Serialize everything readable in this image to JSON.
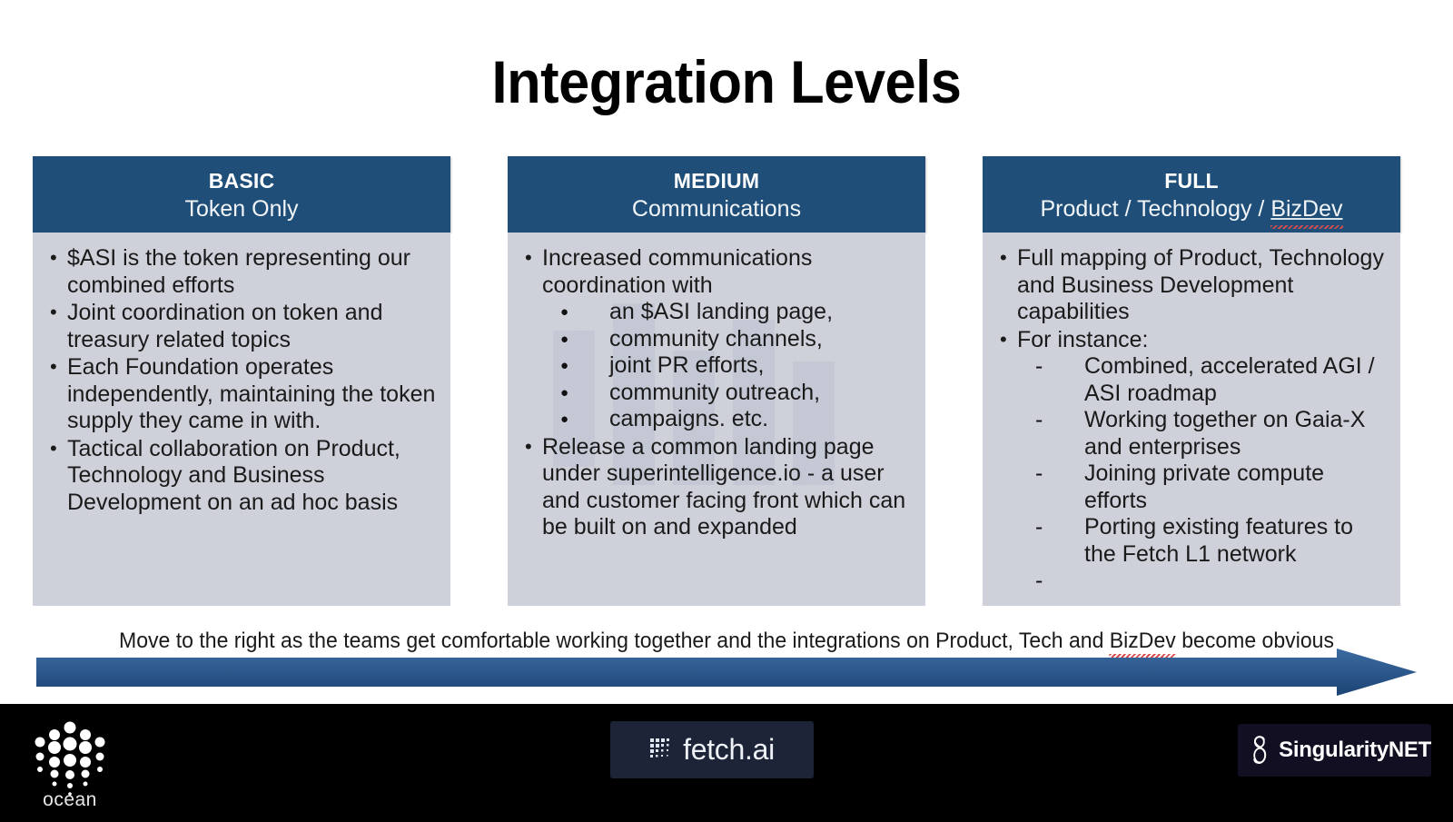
{
  "slide": {
    "title": "Integration Levels"
  },
  "columns": [
    {
      "level": "BASIC",
      "subtitle": "Token Only",
      "bullets": [
        {
          "text": "$ASI is the token representing our combined efforts"
        },
        {
          "text": "Joint coordination on token and treasury related topics"
        },
        {
          "text": "Each Foundation operates independently, maintaining the token supply they came in with."
        },
        {
          "text": "Tactical collaboration on Product, Technology and Business Development on an ad hoc basis"
        }
      ]
    },
    {
      "level": "MEDIUM",
      "subtitle": "Communications",
      "bullets": [
        {
          "text": "Increased communications coordination with",
          "sub_marker": "dot",
          "sub": [
            "an $ASI landing page,",
            "community channels,",
            "joint PR efforts,",
            "community outreach,",
            "campaigns. etc."
          ]
        },
        {
          "text": "Release a common landing page under superintelligence.io - a user and customer facing front which can be built on and expanded"
        }
      ]
    },
    {
      "level": "FULL",
      "subtitle_parts": {
        "prefix": "Product / Technology / ",
        "flagged": "BizDev"
      },
      "bullets": [
        {
          "text": "Full mapping of Product, Technology and Business Development capabilities"
        },
        {
          "text": "For instance:",
          "sub_marker": "dash",
          "sub": [
            "Combined, accelerated AGI / ASI roadmap",
            "Working together on Gaia-X and enterprises",
            "Joining private compute efforts",
            "Porting existing features to the Fetch L1 network",
            ""
          ]
        }
      ]
    }
  ],
  "caption": {
    "before": "Move to the right as the teams get comfortable working together and the integrations on Product, Tech and ",
    "flagged": "BizDev",
    "after": " become obvious"
  },
  "footer": {
    "ocean_label": "ocean",
    "fetch_label": "fetch.ai",
    "singularitynet_label": "SingularityNET"
  },
  "colors": {
    "header_blue": "#1F4E79",
    "panel_gray": "#CFD1DA",
    "arrow_blue": "#2E5A8E",
    "footer_black": "#000000",
    "spellcheck_red": "#D94B4B"
  }
}
